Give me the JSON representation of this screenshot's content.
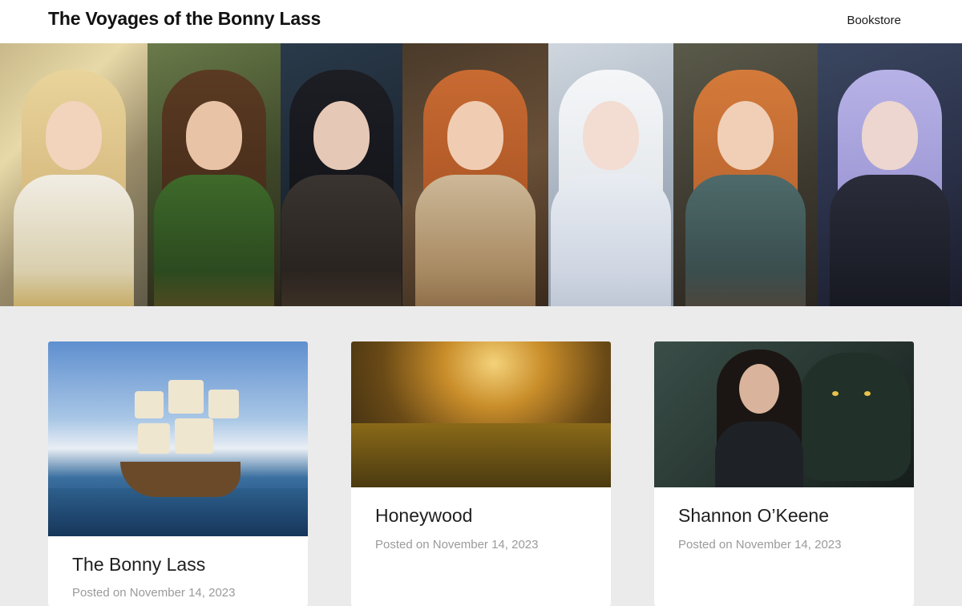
{
  "header": {
    "site_title": "The Voyages of the Bonny Lass",
    "nav": [
      {
        "label": "Bookstore"
      }
    ]
  },
  "hero": {
    "panels": [
      {
        "name": "fair-haired-girl-portrait"
      },
      {
        "name": "brown-haired-glasses-girl-portrait"
      },
      {
        "name": "dark-haired-girl-portrait"
      },
      {
        "name": "red-haired-smiling-girl-portrait"
      },
      {
        "name": "white-haired-girl-portrait"
      },
      {
        "name": "auburn-braided-girl-portrait"
      },
      {
        "name": "lavender-haired-girl-portrait"
      }
    ]
  },
  "posts": [
    {
      "title": "The Bonny Lass",
      "meta_prefix": "Posted on",
      "date": "November 14, 2023",
      "image": "sailing-ship-image"
    },
    {
      "title": "Honeywood",
      "meta_prefix": "Posted on",
      "date": "November 14, 2023",
      "image": "golden-forest-image"
    },
    {
      "title": "Shannon O’Keene",
      "meta_prefix": "Posted on",
      "date": "November 14, 2023",
      "image": "warrior-woman-with-panther-image"
    }
  ]
}
